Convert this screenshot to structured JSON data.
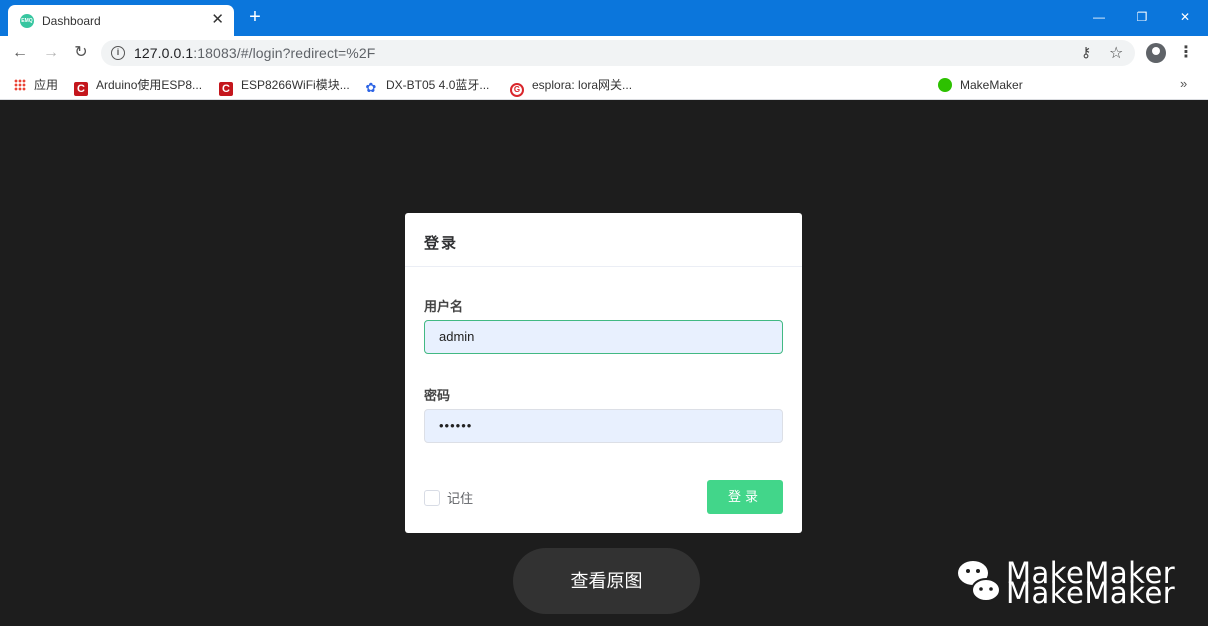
{
  "browser": {
    "tab": {
      "title": "Dashboard",
      "favicon_text": "EMQ",
      "close": "✕"
    },
    "new_tab": "+",
    "window_controls": {
      "minimize": "—",
      "restore": "❐",
      "close": "✕"
    },
    "nav": {
      "back": "←",
      "forward": "→",
      "reload": "↻"
    },
    "address": {
      "host": "127.0.0.1",
      "rest": ":18083/#/login?redirect=%2F"
    },
    "toolbar_icons": {
      "key": "⚷",
      "star": "☆",
      "menu": "⋮"
    },
    "bookmarks": [
      {
        "label": "应用",
        "icon": "apps-grid-icon"
      },
      {
        "label": "Arduino使用ESP8...",
        "icon": "csdn-icon"
      },
      {
        "label": "ESP8266WiFi模块...",
        "icon": "csdn-icon"
      },
      {
        "label": "DX-BT05 4.0蓝牙...",
        "icon": "baidu-paw-icon"
      },
      {
        "label": "esplora: lora网关...",
        "icon": "gitee-icon"
      },
      {
        "label": "MakeMaker",
        "icon": "wechat-icon"
      }
    ],
    "bookmarks_more": "»"
  },
  "login": {
    "title": "登录",
    "username_label": "用户名",
    "username_value": "admin",
    "password_label": "密码",
    "password_value": "••••••",
    "remember_label": "记住",
    "remember_checked": false,
    "submit_label": "登录"
  },
  "overlay": {
    "view_original": "查看原图",
    "watermark": "MakeMaker"
  },
  "colors": {
    "titlebar": "#0b76dc",
    "page_bg": "#1d1d1d",
    "accent": "#42b983",
    "button": "#42d68a"
  }
}
